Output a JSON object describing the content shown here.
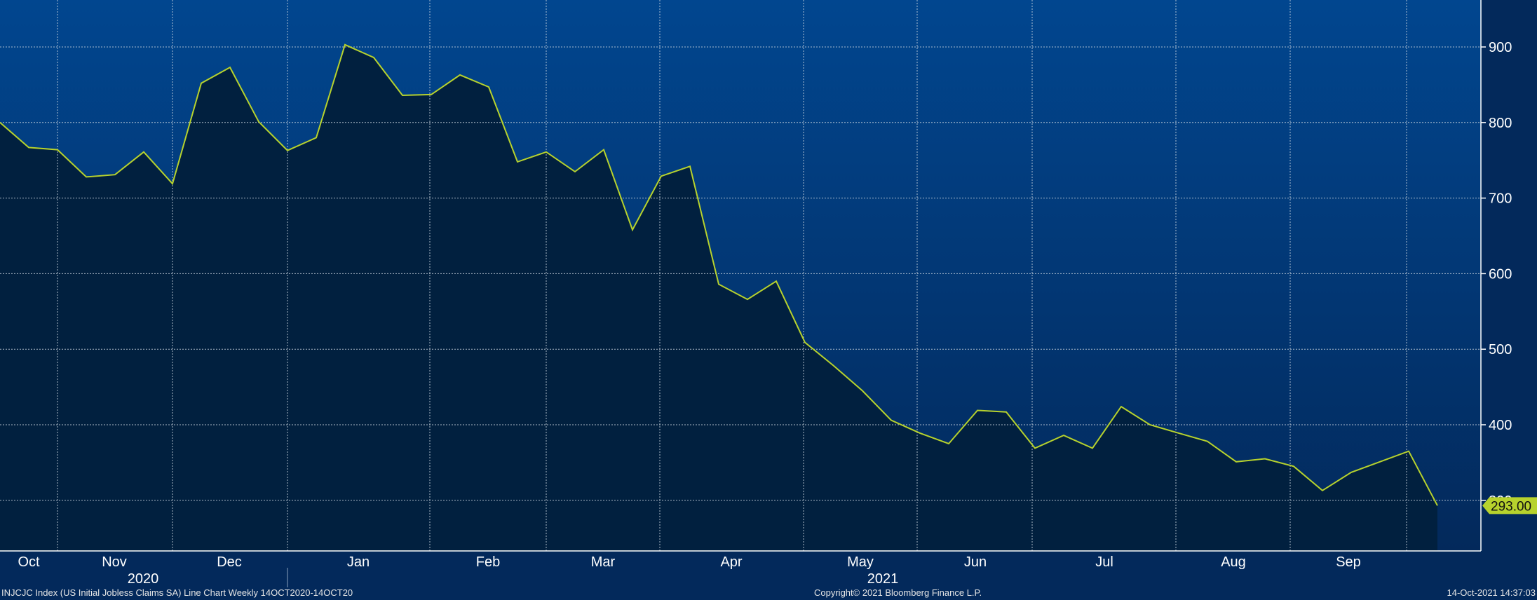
{
  "chart_data": {
    "type": "area",
    "series": [
      {
        "values": [
          800,
          767,
          764,
          728,
          731,
          761,
          719,
          852,
          873,
          801,
          763,
          780,
          903,
          886,
          836,
          837,
          863,
          847,
          748,
          761,
          735,
          764,
          658,
          729,
          742,
          586,
          566,
          590,
          509,
          478,
          445,
          406,
          389,
          375,
          419,
          417,
          369,
          386,
          369,
          424,
          400,
          389,
          378,
          351,
          355,
          345,
          313,
          337,
          351,
          365,
          293
        ]
      }
    ],
    "ylim": [
      235,
      965
    ],
    "yticks": [
      300,
      400,
      500,
      600,
      700,
      800,
      900
    ],
    "months": [
      "Oct",
      "Nov",
      "Dec",
      "Jan",
      "Feb",
      "Mar",
      "Apr",
      "May",
      "Jun",
      "Jul",
      "Aug",
      "Sep"
    ],
    "years": [
      "2020",
      "2021"
    ],
    "last_value_label": "293.00",
    "grid": true,
    "colors": {
      "line": "#b7d22d",
      "fill": "#01203f",
      "bg_top": "#01468f",
      "bg_bottom": "#03295b",
      "grid": "#c9d3de",
      "text": "#ffffff",
      "badge": "#b7d22d"
    }
  },
  "footer": {
    "source": "INJCJC Index (US Initial Jobless Claims SA) Line Chart  Weekly 14OCT2020-14OCT20",
    "copyright": "Copyright© 2021 Bloomberg Finance L.P.",
    "timestamp": "14-Oct-2021 14:37:03"
  }
}
